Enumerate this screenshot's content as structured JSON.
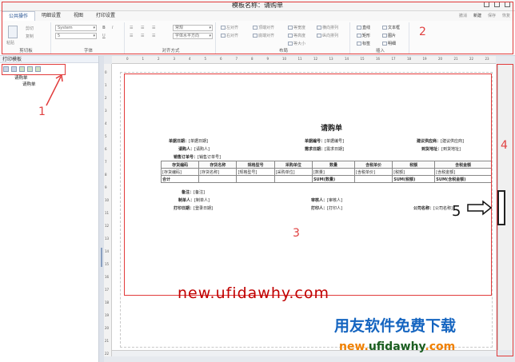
{
  "window": {
    "title": "模板名称：请购单"
  },
  "tabs": [
    "公共操作",
    "明细设置",
    "视图",
    "打印设置"
  ],
  "toolbar_right": [
    "撤消",
    "新建",
    "保存",
    "恢复"
  ],
  "ribbon": {
    "clipboard": {
      "label": "剪切板",
      "cut": "剪切",
      "copy": "复制",
      "paste": "粘贴"
    },
    "font": {
      "label": "字体",
      "family": "System",
      "size": "5",
      "bold": "B",
      "italic": "I",
      "underline": "U"
    },
    "align": {
      "label": "对齐方式",
      "style": "常规",
      "horizontal": "字体水平方向"
    },
    "layout": {
      "label": "布局",
      "items": [
        "左对齐",
        "右对齐",
        "顶端对齐",
        "底端对齐",
        "等宽度",
        "等高度",
        "等大小",
        "横向排列",
        "纵向排列"
      ]
    },
    "insert": {
      "label": "插入",
      "items": [
        "直线",
        "文本框",
        "矩形",
        "图片",
        "标签",
        "明细"
      ]
    }
  },
  "left_panel": {
    "title": "打印模板",
    "tree_root": "请购单",
    "tree_child": "请购单"
  },
  "ruler": {
    "h": [
      "0",
      "1",
      "2",
      "3",
      "4",
      "5",
      "6",
      "7",
      "8",
      "9",
      "10",
      "11",
      "12",
      "13",
      "14",
      "15",
      "16",
      "17",
      "18",
      "19",
      "20",
      "21",
      "22",
      "23"
    ],
    "v": [
      "0",
      "1",
      "2",
      "3",
      "4",
      "5",
      "6",
      "7",
      "8",
      "9",
      "10",
      "11",
      "12",
      "13",
      "14",
      "15",
      "16",
      "17",
      "18",
      "19",
      "20",
      "21",
      "22"
    ]
  },
  "document": {
    "title": "请购单",
    "fields": [
      {
        "label": "单据日期：",
        "value": "[单据日期]"
      },
      {
        "label": "单据编号：",
        "value": "[单据编号]"
      },
      {
        "label": "建议供应商：",
        "value": "[建议供应商]"
      },
      {
        "label": "请购人：",
        "value": "[请购人]"
      },
      {
        "label": "需求日期：",
        "value": "[需求日期]"
      },
      {
        "label": "到货地址：",
        "value": "[到货地址]"
      },
      {
        "label": "销售订单号：",
        "value": "[销售订单号]"
      }
    ],
    "columns": [
      "存货编码",
      "存货名称",
      "规格型号",
      "采购单位",
      "数量",
      "含税单价",
      "税额",
      "含税金额"
    ],
    "cells": [
      "[存货编码]",
      "[存货名称]",
      "[规格型号]",
      "[采购单位]",
      "[数量]",
      "[含税单价]",
      "[税额]",
      "[含税金额]"
    ],
    "total_label": "合计",
    "total_qty": "SUM(数量)",
    "total_tax": "SUM(税额)",
    "total_amt": "SUM(含税金额)",
    "remark_label": "备注：",
    "remark_value": "[备注]",
    "maker_label": "制单人：",
    "maker_value": "[制单人]",
    "auditor_label": "审核人：",
    "auditor_value": "[审核人]",
    "print_date_label": "打印日期：",
    "print_date_value": "[登录日期]",
    "printer_label": "打印人：",
    "printer_value": "[打印人]",
    "company_label": "公司名称：",
    "company_value": "[公司名称]"
  },
  "annotations": [
    "1",
    "2",
    "3",
    "4",
    "5"
  ],
  "watermark": {
    "url": "new.ufidawhy.com",
    "brand": "用友软件免费下载",
    "url2a": "new.",
    "url2b": "ufidawhy",
    "url2c": ".com"
  },
  "colors": {
    "annotation": "#e23b3b",
    "brand_blue": "#1565c0",
    "brand_orange": "#f08000",
    "url_red": "#c00000"
  }
}
